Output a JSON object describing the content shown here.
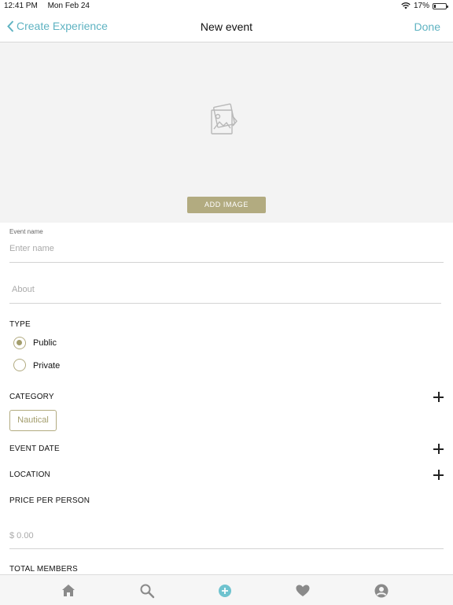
{
  "status_bar": {
    "time": "12:41 PM",
    "date": "Mon Feb 24",
    "battery": "17%",
    "battery_level": 0.17
  },
  "nav": {
    "back_label": "Create Experience",
    "title": "New event",
    "done_label": "Done"
  },
  "image_section": {
    "add_image_label": "ADD IMAGE",
    "placeholder_icon": "image-placeholder-icon"
  },
  "form": {
    "event_name": {
      "label": "Event name",
      "placeholder": "Enter name"
    },
    "about": {
      "placeholder": "About"
    },
    "type": {
      "label": "TYPE",
      "options": [
        {
          "label": "Public",
          "selected": true
        },
        {
          "label": "Private",
          "selected": false
        }
      ]
    },
    "category": {
      "label": "CATEGORY",
      "chips": [
        "Nautical"
      ]
    },
    "event_date": {
      "label": "EVENT DATE"
    },
    "location": {
      "label": "LOCATION"
    },
    "price": {
      "label": "PRICE PER PERSON",
      "placeholder": "$ 0.00"
    },
    "total_members": {
      "label": "TOTAL MEMBERS"
    }
  },
  "tab_bar": {
    "items": [
      {
        "icon": "home-icon",
        "active": false
      },
      {
        "icon": "search-icon",
        "active": false
      },
      {
        "icon": "add-circle-icon",
        "active": true
      },
      {
        "icon": "heart-icon",
        "active": false
      },
      {
        "icon": "profile-icon",
        "active": false
      }
    ]
  },
  "colors": {
    "accent": "#5fb3c2",
    "olive": "#b2ab80"
  }
}
